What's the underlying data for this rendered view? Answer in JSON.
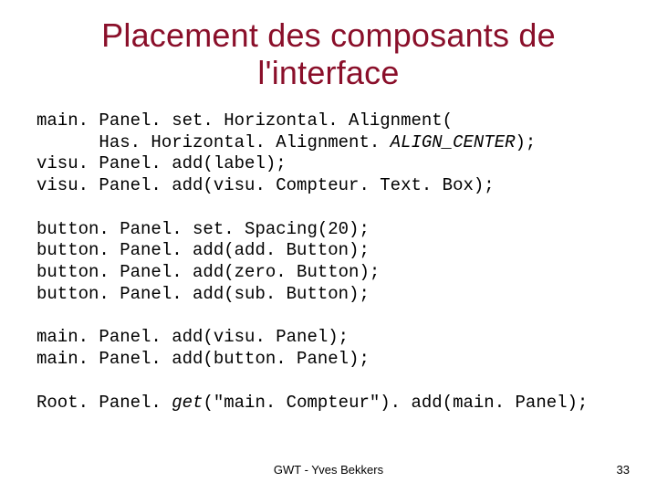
{
  "title": "Placement des composants de l'interface",
  "code": {
    "l01a": "main. Panel. set. Horizontal. Alignment(",
    "l02a": "      Has. Horizontal. Alignment. ",
    "l02b": "ALIGN_CENTER",
    "l02c": ");",
    "l03": "visu. Panel. add(label);",
    "l04": "visu. Panel. add(visu. Compteur. Text. Box);",
    "l05": "",
    "l06": "button. Panel. set. Spacing(20);",
    "l07": "button. Panel. add(add. Button);",
    "l08": "button. Panel. add(zero. Button);",
    "l09": "button. Panel. add(sub. Button);",
    "l10": "",
    "l11": "main. Panel. add(visu. Panel);",
    "l12": "main. Panel. add(button. Panel);",
    "l13": "",
    "l14a": "Root. Panel. ",
    "l14b": "get",
    "l14c": "(\"main. Compteur\"). add(main. Panel);"
  },
  "footer": {
    "center": "GWT - Yves Bekkers",
    "page": "33"
  }
}
